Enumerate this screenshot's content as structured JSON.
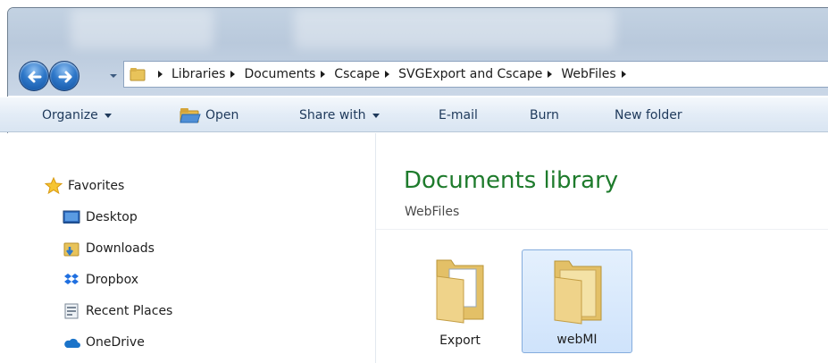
{
  "address_bar": {
    "breadcrumbs": [
      "Libraries",
      "Documents",
      "Cscape",
      "SVGExport and Cscape",
      "WebFiles"
    ]
  },
  "command_bar": {
    "organize_label": "Organize",
    "open_label": "Open",
    "share_with_label": "Share with",
    "email_label": "E-mail",
    "burn_label": "Burn",
    "new_folder_label": "New folder"
  },
  "nav_pane": {
    "favorites_label": "Favorites",
    "items": [
      {
        "label": "Desktop",
        "icon": "desktop-icon"
      },
      {
        "label": "Downloads",
        "icon": "downloads-folder-icon"
      },
      {
        "label": "Dropbox",
        "icon": "dropbox-icon"
      },
      {
        "label": "Recent Places",
        "icon": "recent-places-icon"
      },
      {
        "label": "OneDrive",
        "icon": "onedrive-icon"
      }
    ]
  },
  "content": {
    "library_title": "Documents library",
    "library_subtitle": "WebFiles",
    "files": [
      {
        "name": "Export",
        "type": "folder",
        "selected": false
      },
      {
        "name": "webMI",
        "type": "folder",
        "selected": true
      }
    ]
  },
  "colors": {
    "library_title": "#1e7b2c",
    "command_text": "#1e395b",
    "selection_border": "#84acdd"
  }
}
